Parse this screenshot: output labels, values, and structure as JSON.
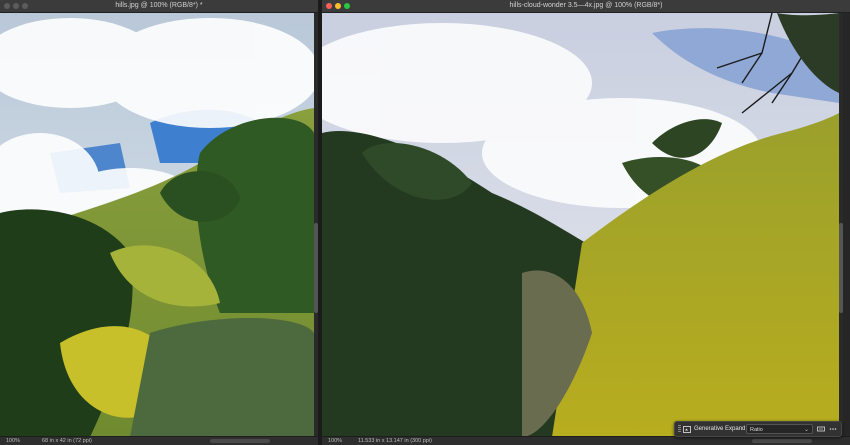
{
  "left_window": {
    "title": "hills.jpg @ 100% (RGB/8*) *",
    "zoom": "100%",
    "doc_info": "68 in x 42 in (72 ppi)"
  },
  "right_window": {
    "title": "hills-cloud-wonder 3.5—4x.jpg @ 100% (RGB/8*)",
    "zoom": "100%",
    "doc_info": "11.533 in x 13.147 in (300 ppi)"
  },
  "context_bar": {
    "generate_label": "Generative Expand",
    "ratio_value": "Ratio",
    "icons": [
      "generative-expand-icon",
      "chevron-down-icon",
      "swap-orientation-icon",
      "more-options-icon"
    ]
  },
  "colors": {
    "close": "#ff5f57",
    "minimize": "#febc2e",
    "maximize": "#28c840",
    "inactive_light": "#5c5c5c"
  }
}
